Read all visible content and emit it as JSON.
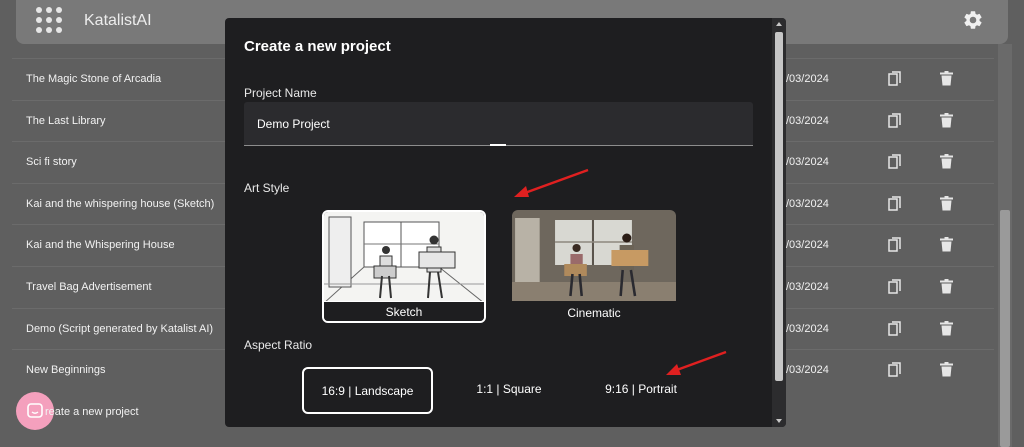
{
  "app": {
    "name": "KatalistAI",
    "logo_icon": "dots-grid-logo",
    "settings_icon": "gear-icon"
  },
  "projects": [
    {
      "name": "The Magic Stone of Arcadia",
      "date": "/03/2024"
    },
    {
      "name": "The Last Library",
      "date": "/03/2024"
    },
    {
      "name": "Sci fi story",
      "date": "/03/2024"
    },
    {
      "name": "Kai and the whispering house (Sketch)",
      "date": "/03/2024"
    },
    {
      "name": "Kai and the Whispering House",
      "date": "/03/2024"
    },
    {
      "name": "Travel Bag Advertisement",
      "date": "/03/2024"
    },
    {
      "name": "Demo (Script generated by Katalist AI)",
      "date": "/03/2024"
    },
    {
      "name": "New Beginnings",
      "date": "/03/2024"
    }
  ],
  "create_row_label": "reate a new project",
  "modal": {
    "title": "Create a new project",
    "project_name_label": "Project Name",
    "project_name_value": "Demo Project",
    "art_style_label": "Art Style",
    "art_styles": [
      {
        "label": "Sketch",
        "selected": true
      },
      {
        "label": "Cinematic",
        "selected": false
      }
    ],
    "aspect_ratio_label": "Aspect Ratio",
    "aspect_ratios": [
      {
        "label": "16:9 | Landscape",
        "selected": true
      },
      {
        "label": "1:1 | Square",
        "selected": false
      },
      {
        "label": "9:16 | Portrait",
        "selected": false
      }
    ]
  },
  "colors": {
    "accent_arrow": "#e02020",
    "chat_bubble": "#f4a0bd",
    "modal_bg": "#1e1e20"
  }
}
